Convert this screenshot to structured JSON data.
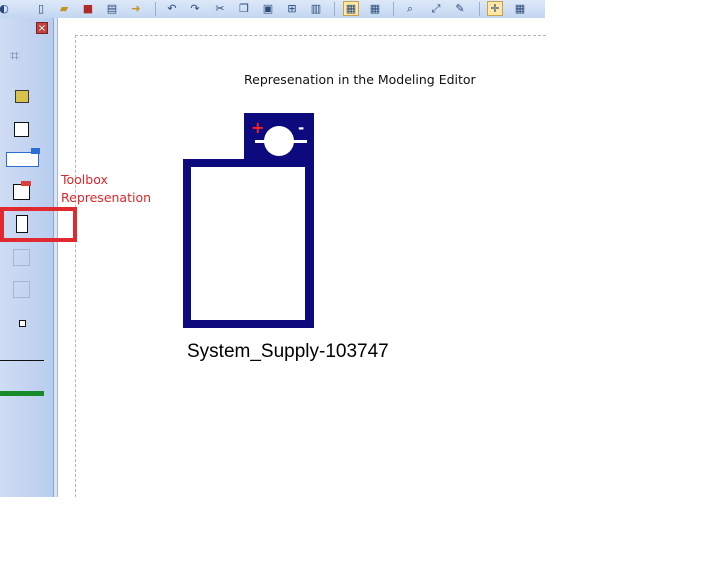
{
  "canvas": {
    "title": "Represenation in the Modeling Editor",
    "toolbox_label_line1": "Toolbox",
    "toolbox_label_line2": "Represenation",
    "symbol_name": "System_Supply-103747"
  },
  "toolbox": {
    "close_glyph": "×",
    "grip_glyph": "⌗"
  },
  "toolbar": {
    "icons": [
      "app-icon",
      "new-icon",
      "open-icon",
      "save-icon",
      "print-icon",
      "export-icon",
      "undo-icon",
      "redo-icon",
      "cut-icon",
      "copy-icon",
      "paste-icon",
      "find-icon",
      "properties-icon",
      "view-icon",
      "grid-icon",
      "zoom-icon",
      "zoom-fit-icon",
      "edit-icon",
      "snap-icon",
      "table-icon"
    ]
  },
  "colors": {
    "symbol_fill": "#0c0a7d",
    "highlight": "#e02a2f",
    "annotation_text": "#e0262a",
    "plus_sign": "#ff2020",
    "toolbox_bg": "#c7d8f2"
  }
}
